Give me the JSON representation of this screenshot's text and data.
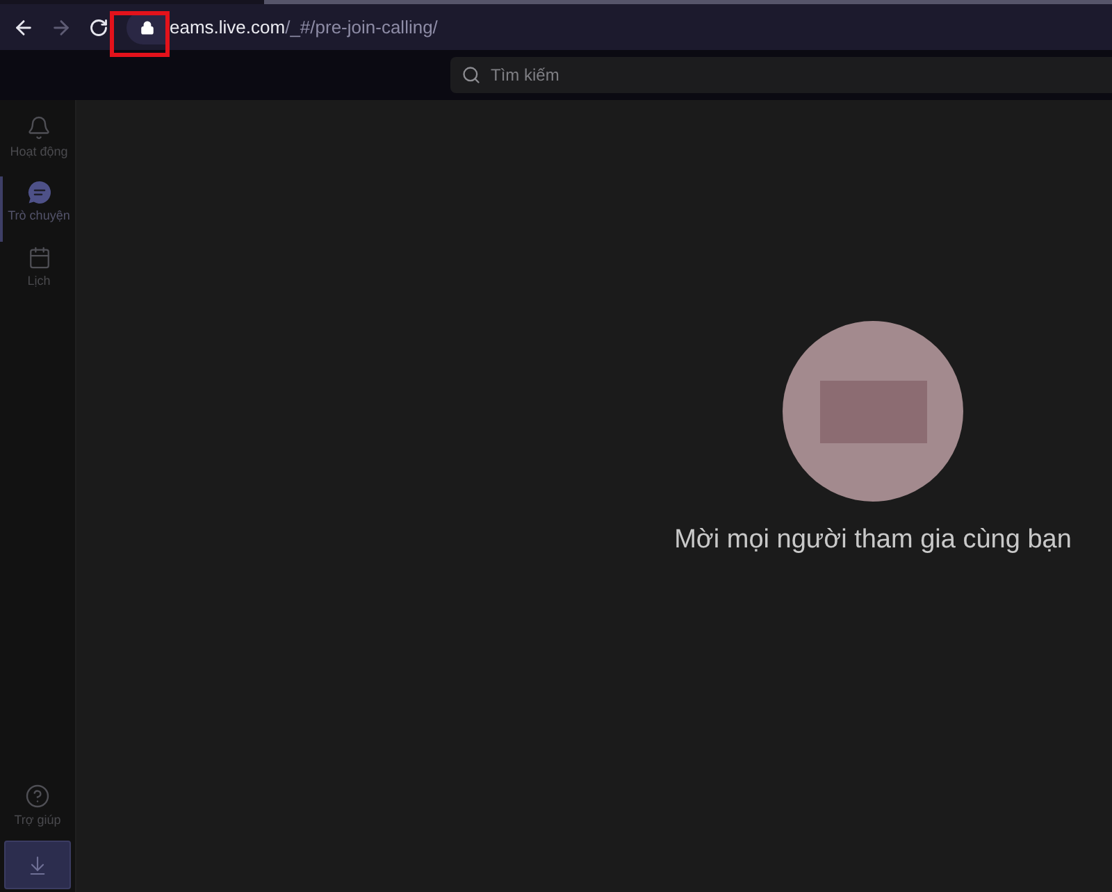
{
  "browser": {
    "nav_buttons": [
      {
        "kind": "back",
        "disabled": false
      },
      {
        "kind": "forward",
        "disabled": true
      },
      {
        "kind": "reload",
        "disabled": false
      }
    ],
    "address": {
      "host": "eams.live.com",
      "path": "/_#/pre-join-calling/"
    }
  },
  "header": {
    "search": {
      "placeholder": "Tìm kiếm"
    }
  },
  "sidebar": {
    "items": [
      {
        "kind": "activity",
        "label": "Hoạt động",
        "selected": false
      },
      {
        "kind": "chat",
        "label": "Trò chuyện",
        "selected": true
      },
      {
        "kind": "calendar",
        "label": "Lịch",
        "selected": false
      }
    ],
    "footer_items": [
      {
        "kind": "help",
        "label": "Trợ giúp"
      }
    ],
    "download_button": {
      "kind": "download"
    }
  },
  "main": {
    "invite_text": "Mời mọi người tham gia cùng bạn"
  }
}
